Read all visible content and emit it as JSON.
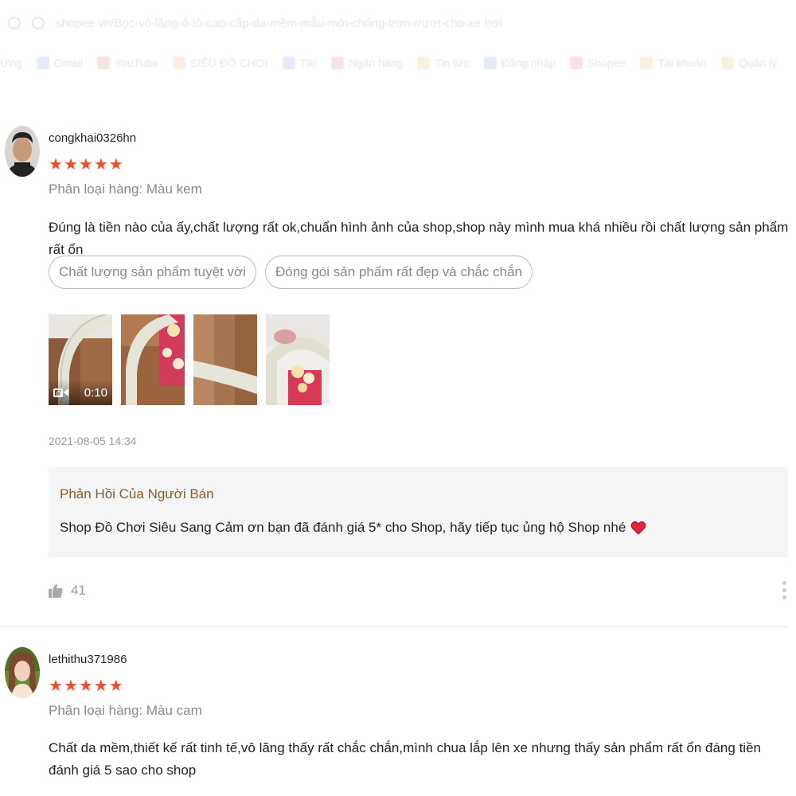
{
  "browser": {
    "url": "shopee.vn/Bọc-vô-lăng-ô-tô-cao-cấp-da-mềm-mẫu-mới-chống-trơn-trượt-cho-xe-hơi",
    "bookmarks": [
      "Ứng",
      "Gmail",
      "YouTube",
      "SIÊU ĐỒ CHƠI",
      "Tiki",
      "Ngân hàng",
      "Tin tức",
      "Đăng nhập",
      "Shopee",
      "Tài khoản",
      "Quản lý"
    ]
  },
  "reviews": [
    {
      "username": "congkhai0326hn",
      "rating": 5,
      "variation": "Phân loại hàng: Màu kem",
      "comment": "Đúng là tiền nào của ấy,chất lượng rất ok,chuẩn hình ảnh của shop,shop này mình mua khá nhiều rồi chất lượng sản phẩm rất ổn",
      "tags": [
        "Chất lượng sản phẩm tuyệt vời",
        "Đóng gói sản phẩm rất đẹp và chắc chắn"
      ],
      "video_duration": "0:10",
      "timestamp": "2021-08-05 14:34",
      "seller_reply_title": "Phản Hồi Của Người Bán",
      "seller_reply_text": "Shop Đồ Chơi Siêu Sang Cảm ơn bạn đã đánh giá 5* cho Shop, hãy tiếp tục ủng hộ Shop nhé",
      "likes": "41"
    },
    {
      "username": "lethithu371986",
      "rating": 5,
      "variation": "Phân loại hàng: Màu cam",
      "comment": "Chất da mềm,thiết kế rất tinh tế,vô lăng thấy rất chắc chắn,mình chua lắp lên xe nhưng thấy sản phẩm rất ổn đáng tiền đánh giá 5 sao cho shop"
    }
  ],
  "colors": {
    "star": "#ee4d2d",
    "seller_title": "#8b5a2b",
    "seller_bg": "#f5f5f5"
  },
  "icons": {
    "star": "star-icon",
    "like": "thumbs-up-icon",
    "more": "more-vertical-icon",
    "video": "video-camera-icon",
    "heart": "heart-icon"
  }
}
